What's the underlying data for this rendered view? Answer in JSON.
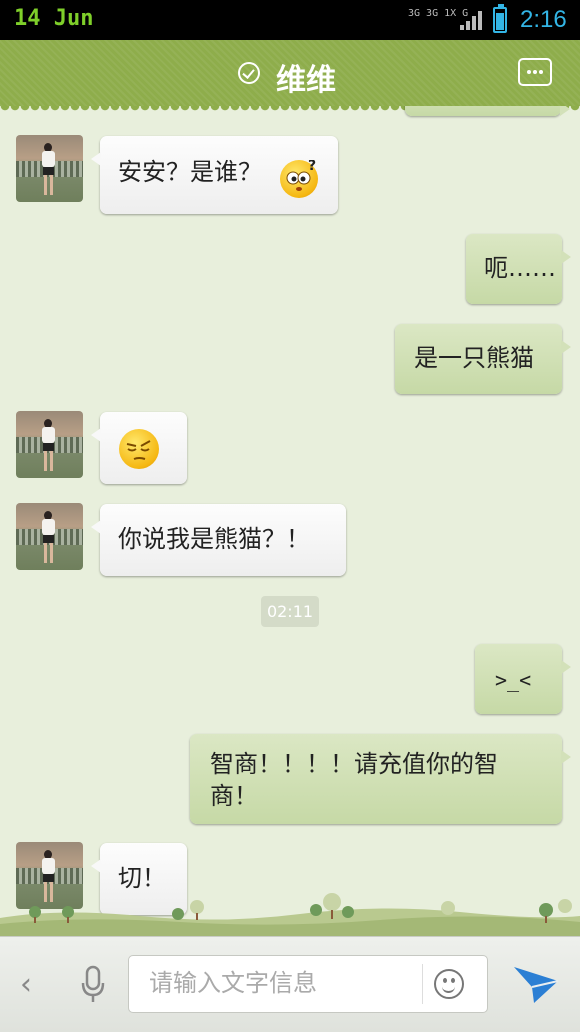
{
  "status_bar": {
    "date": "14 Jun",
    "network_text": "3G 3G 1X G",
    "time": "2:16",
    "battery_level": 0.85,
    "accent_color": "#33b5e5"
  },
  "header": {
    "contact_name": "维维",
    "status_icon": "check-circle-icon",
    "menu_icon": "chat-more-icon",
    "color": "#8ead4b"
  },
  "messages": [
    {
      "side": "left",
      "text": "安安？是谁？",
      "emoji": "confused-face"
    },
    {
      "side": "right",
      "text": "呃……"
    },
    {
      "side": "right",
      "text": "是一只熊猫"
    },
    {
      "side": "left",
      "text": "",
      "emoji": "smug-face"
    },
    {
      "side": "left",
      "text": "你说我是熊猫？！"
    },
    {
      "side": "right",
      "text": ">_<"
    },
    {
      "side": "right",
      "text": "智商！！！！请充值你的智商！"
    },
    {
      "side": "left",
      "text": "切！"
    }
  ],
  "timestamp": "02:11",
  "input_bar": {
    "back_icon": "chevron-left-icon",
    "voice_icon": "microphone-icon",
    "placeholder": "请输入文字信息",
    "emoji_icon": "smiley-icon",
    "send_icon": "paper-plane-icon",
    "send_color": "#2b7fd4"
  }
}
